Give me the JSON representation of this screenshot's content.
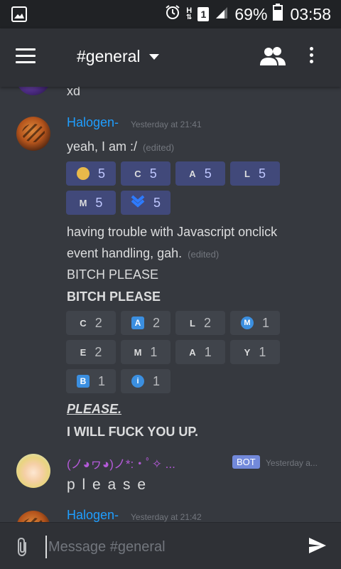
{
  "statusbar": {
    "battery_pct": "69%",
    "time": "03:58",
    "sim_badge": "1",
    "net_letter": "H"
  },
  "toolbar": {
    "channel": "#general"
  },
  "messages": {
    "prev_line": "xd",
    "m1": {
      "username": "Halogen-",
      "timestamp": "Yesterday at 21:41",
      "line1": "yeah, I am :/",
      "edited1": "(edited)",
      "line2": "having trouble with Javascript onclick",
      "line3": "event handling, gah.",
      "edited2": "(edited)",
      "line4": "BITCH PLEASE",
      "line5": "BITCH PLEASE",
      "line6": "PLEASE.",
      "line7": "I WILL FUCK YOU UP."
    },
    "m2": {
      "username": "(ノ◕ヮ◕)ノ*:・ﾟ✧ ...",
      "bot_badge": "BOT",
      "timestamp": "Yesterday a...",
      "line1": "p l e a s e"
    },
    "m3": {
      "username": "Halogen-",
      "timestamp": "Yesterday at 21:42"
    }
  },
  "reactions_a": [
    {
      "emoji": "face",
      "count": "5"
    },
    {
      "emoji": "C",
      "count": "5"
    },
    {
      "emoji": "A",
      "count": "5"
    },
    {
      "emoji": "L",
      "count": "5"
    },
    {
      "emoji": "M",
      "count": "5"
    },
    {
      "emoji": "arrow-down",
      "count": "5"
    }
  ],
  "reactions_b": [
    {
      "emoji": "C",
      "count": "2"
    },
    {
      "emoji": "A-square",
      "count": "2"
    },
    {
      "emoji": "L",
      "count": "2"
    },
    {
      "emoji": "M-circle",
      "count": "1"
    },
    {
      "emoji": "E",
      "count": "2"
    },
    {
      "emoji": "M",
      "count": "1"
    },
    {
      "emoji": "A",
      "count": "1"
    },
    {
      "emoji": "Y",
      "count": "1"
    },
    {
      "emoji": "B-square",
      "count": "1"
    },
    {
      "emoji": "info-circle",
      "count": "1"
    }
  ],
  "reaction_glyphs": {
    "C": "C",
    "A": "A",
    "L": "L",
    "M": "M",
    "E": "E",
    "Y": "Y",
    "A_square": "A",
    "B_square": "B",
    "M_circle": "M",
    "info": "i"
  },
  "input": {
    "placeholder": "Message #general"
  },
  "colors": {
    "background": "#36393f",
    "toolbar": "#2f3136",
    "statusbar": "#202225",
    "username": "#1f9eff",
    "bot_name": "#b45ad8",
    "bot_badge": "#7289da",
    "reaction_me": "#41497a",
    "reaction": "#40444b"
  }
}
